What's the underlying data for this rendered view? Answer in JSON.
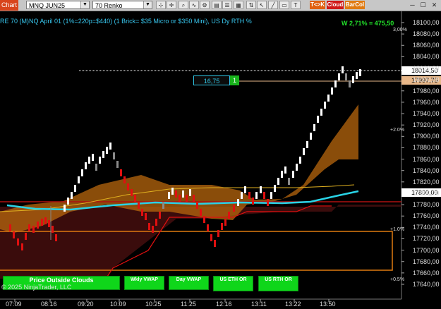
{
  "toolbar": {
    "app_tab": "Chart",
    "instrument": "MNQ JUN25",
    "bar_type": "70 Renko",
    "tags": [
      "T<>K",
      "Cloud",
      "BarCol"
    ]
  },
  "chart": {
    "header_text": "RE 70 (M)NQ April 01 (1%=220p=$440) (1 Brick= $35 Micro or $350 Mini), US Dy RTH %",
    "week_text": "W 2,71% = 475,50",
    "position_box_value": "16,75",
    "position_box_qty": "1",
    "last_price": "18014,50",
    "cursor_price": "17997,75",
    "marked_price": "17800,00",
    "copyright": "© 2025 NinjaTrader, LLC",
    "price_axis": [
      "18100,00",
      "18080,00",
      "18060,00",
      "18040,00",
      "18020,00",
      "18000,00",
      "17980,00",
      "17960,00",
      "17940,00",
      "17920,00",
      "17900,00",
      "17880,00",
      "17860,00",
      "17840,00",
      "17820,00",
      "17800,00",
      "17780,00",
      "17760,00",
      "17740,00",
      "17720,00",
      "17700,00",
      "17680,00",
      "17660,00",
      "17640,00"
    ],
    "time_axis": [
      "07:09",
      "08:16",
      "09:20",
      "10:09",
      "10:25",
      "11:25",
      "12:16",
      "13:11",
      "13:22",
      "13:50"
    ],
    "pct_levels": [
      "3,00%",
      "+2.0%",
      "+1.0%",
      "+0.5%"
    ],
    "buttons": [
      "Price Outside Clouds",
      "Wkly VWAP",
      "Day VWAP",
      "US ETH OR",
      "US RTH OR"
    ],
    "colors": {
      "up_brick": "#ffffff",
      "down_brick": "#e01010",
      "neutral_brick": "#8a8a8a",
      "cloud": "#b8670d",
      "vwap_line": "#29d3e6",
      "weekly_vwap": "#e0b020",
      "button_green": "#0fd61a"
    }
  }
}
